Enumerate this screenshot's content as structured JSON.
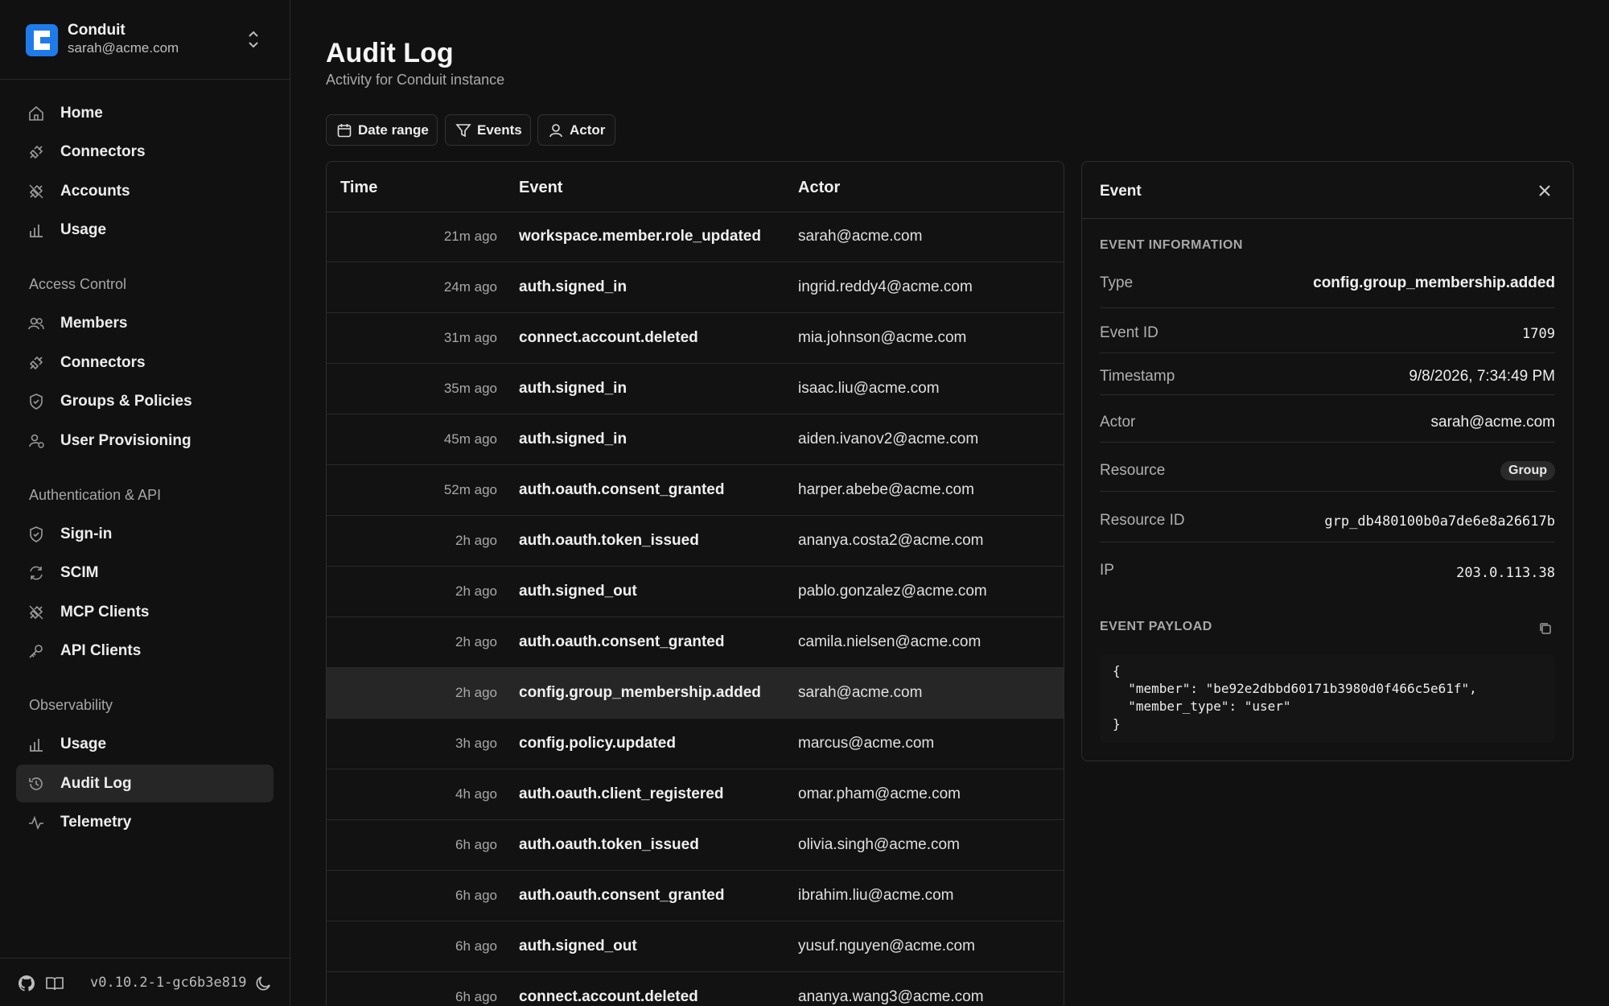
{
  "workspace": {
    "name": "Conduit",
    "email": "sarah@acme.com"
  },
  "nav": {
    "main": [
      {
        "label": "Home",
        "icon": "home-icon"
      },
      {
        "label": "Connectors",
        "icon": "plug-icon"
      },
      {
        "label": "Accounts",
        "icon": "plug-icon"
      },
      {
        "label": "Usage",
        "icon": "bar-chart-icon"
      }
    ],
    "sections": [
      {
        "title": "Access Control",
        "items": [
          {
            "label": "Members",
            "icon": "users-icon"
          },
          {
            "label": "Connectors",
            "icon": "plug-icon"
          },
          {
            "label": "Groups & Policies",
            "icon": "shield-icon"
          },
          {
            "label": "User Provisioning",
            "icon": "user-sync-icon"
          }
        ]
      },
      {
        "title": "Authentication & API",
        "items": [
          {
            "label": "Sign-in",
            "icon": "shield-check-icon"
          },
          {
            "label": "SCIM",
            "icon": "refresh-icon"
          },
          {
            "label": "MCP Clients",
            "icon": "plug-icon"
          },
          {
            "label": "API Clients",
            "icon": "key-icon"
          }
        ]
      },
      {
        "title": "Observability",
        "items": [
          {
            "label": "Usage",
            "icon": "bar-chart-icon"
          },
          {
            "label": "Audit Log",
            "icon": "history-icon",
            "active": true
          },
          {
            "label": "Telemetry",
            "icon": "activity-icon"
          }
        ]
      }
    ]
  },
  "footer": {
    "version": "v0.10.2-1-gc6b3e819"
  },
  "page": {
    "title": "Audit Log",
    "subtitle": "Activity for Conduit instance"
  },
  "filters": {
    "date_range": "Date range",
    "events": "Events",
    "actor": "Actor"
  },
  "table": {
    "columns": [
      "Time",
      "Event",
      "Actor"
    ],
    "rows": [
      {
        "time": "21m ago",
        "event": "workspace.member.role_updated",
        "actor": "sarah@acme.com"
      },
      {
        "time": "24m ago",
        "event": "auth.signed_in",
        "actor": "ingrid.reddy4@acme.com"
      },
      {
        "time": "31m ago",
        "event": "connect.account.deleted",
        "actor": "mia.johnson@acme.com"
      },
      {
        "time": "35m ago",
        "event": "auth.signed_in",
        "actor": "isaac.liu@acme.com"
      },
      {
        "time": "45m ago",
        "event": "auth.signed_in",
        "actor": "aiden.ivanov2@acme.com"
      },
      {
        "time": "52m ago",
        "event": "auth.oauth.consent_granted",
        "actor": "harper.abebe@acme.com"
      },
      {
        "time": "2h ago",
        "event": "auth.oauth.token_issued",
        "actor": "ananya.costa2@acme.com"
      },
      {
        "time": "2h ago",
        "event": "auth.signed_out",
        "actor": "pablo.gonzalez@acme.com"
      },
      {
        "time": "2h ago",
        "event": "auth.oauth.consent_granted",
        "actor": "camila.nielsen@acme.com"
      },
      {
        "time": "2h ago",
        "event": "config.group_membership.added",
        "actor": "sarah@acme.com",
        "selected": true
      },
      {
        "time": "3h ago",
        "event": "config.policy.updated",
        "actor": "marcus@acme.com"
      },
      {
        "time": "4h ago",
        "event": "auth.oauth.client_registered",
        "actor": "omar.pham@acme.com"
      },
      {
        "time": "6h ago",
        "event": "auth.oauth.token_issued",
        "actor": "olivia.singh@acme.com"
      },
      {
        "time": "6h ago",
        "event": "auth.oauth.consent_granted",
        "actor": "ibrahim.liu@acme.com"
      },
      {
        "time": "6h ago",
        "event": "auth.signed_out",
        "actor": "yusuf.nguyen@acme.com"
      },
      {
        "time": "6h ago",
        "event": "connect.account.deleted",
        "actor": "ananya.wang3@acme.com"
      }
    ]
  },
  "panel": {
    "title": "Event",
    "info_heading": "EVENT INFORMATION",
    "fields": {
      "type": {
        "label": "Type",
        "value": "config.group_membership.added"
      },
      "event_id": {
        "label": "Event ID",
        "value": "1709"
      },
      "timestamp": {
        "label": "Timestamp",
        "value": "9/8/2026, 7:34:49 PM"
      },
      "actor": {
        "label": "Actor",
        "value": "sarah@acme.com"
      },
      "resource": {
        "label": "Resource",
        "value": "Group"
      },
      "resource_id": {
        "label": "Resource ID",
        "value": "grp_db480100b0a7de6e8a26617b"
      },
      "ip": {
        "label": "IP",
        "value": "203.0.113.38"
      }
    },
    "payload_heading": "EVENT PAYLOAD",
    "payload": "{\n  \"member\": \"be92e2dbbd60171b3980d0f466c5e61f\",\n  \"member_type\": \"user\"\n}"
  },
  "colors": {
    "background": "#111111",
    "accent": "#1f7bea",
    "selected_row": "#262626"
  }
}
